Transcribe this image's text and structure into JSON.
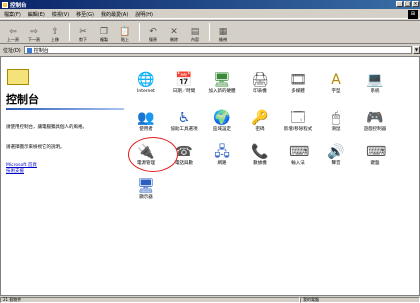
{
  "window": {
    "title": "控制台"
  },
  "menu": [
    "檔案(F)",
    "編輯(E)",
    "檢視(V)",
    "移至(G)",
    "我的最愛(A)",
    "說明(H)"
  ],
  "toolbar": {
    "back": "上一頁",
    "forward": "下一頁",
    "up": "上移",
    "cut": "剪下",
    "copy": "複製",
    "paste": "貼上",
    "undo": "復原",
    "delete": "刪除",
    "properties": "內容",
    "views": "檢視"
  },
  "address": {
    "label": "位址(D)",
    "value": "控制台"
  },
  "left": {
    "title": "控制台",
    "desc": "請使用控制台，讓電腦獨具個人的風格。",
    "hint": "請選擇圖示來檢視它的說明。",
    "link1": "Microsoft 首頁",
    "link2": "技術支援"
  },
  "icons": [
    {
      "id": "internet",
      "label": "Internet",
      "glyph": "🌐",
      "color": "#2a5fbf"
    },
    {
      "id": "datetime",
      "label": "日期／時間",
      "glyph": "📅",
      "color": "#2a5fbf"
    },
    {
      "id": "addhw",
      "label": "加入新的硬體",
      "glyph": "🖥",
      "color": "#3a8a3a"
    },
    {
      "id": "printers",
      "label": "印表機",
      "glyph": "🖨",
      "color": "#555"
    },
    {
      "id": "multimedia",
      "label": "多媒體",
      "glyph": "🎞",
      "color": "#555"
    },
    {
      "id": "fonts",
      "label": "字型",
      "glyph": "A",
      "color": "#b08a00"
    },
    {
      "id": "system",
      "label": "系統",
      "glyph": "💻",
      "color": "#2a5fbf"
    },
    {
      "id": "users",
      "label": "使用者",
      "glyph": "👥",
      "color": "#333"
    },
    {
      "id": "accessibility",
      "label": "協助工具選項",
      "glyph": "♿",
      "color": "#2a5fbf"
    },
    {
      "id": "regional",
      "label": "區域設定",
      "glyph": "🌍",
      "color": "#2a8a2a"
    },
    {
      "id": "passwords",
      "label": "密碼",
      "glyph": "🔑",
      "color": "#b08a00"
    },
    {
      "id": "addremove",
      "label": "新增/移除程式",
      "glyph": "🗔",
      "color": "#555"
    },
    {
      "id": "mouse",
      "label": "滑鼠",
      "glyph": "🖱",
      "color": "#555"
    },
    {
      "id": "gamectrl",
      "label": "遊戲控制器",
      "glyph": "🎮",
      "color": "#555"
    },
    {
      "id": "power",
      "label": "電源管理",
      "glyph": "🔌",
      "color": "#3a8a3a"
    },
    {
      "id": "modems",
      "label": "電話與數",
      "glyph": "☎",
      "color": "#555"
    },
    {
      "id": "network",
      "label": "網路",
      "glyph": "🖧",
      "color": "#2a5fbf"
    },
    {
      "id": "telephony",
      "label": "數據機",
      "glyph": "📞",
      "color": "#b08a00"
    },
    {
      "id": "ime",
      "label": "輸入法",
      "glyph": "⌨",
      "color": "#555"
    },
    {
      "id": "sounds",
      "label": "聲音",
      "glyph": "🔊",
      "color": "#b08a00"
    },
    {
      "id": "keyboard",
      "label": "鍵盤",
      "glyph": "⌨",
      "color": "#555"
    },
    {
      "id": "display",
      "label": "顯示器",
      "glyph": "🖥",
      "color": "#2a5fbf"
    }
  ],
  "status": {
    "left": "21 個物件",
    "right": "我的電腦"
  }
}
